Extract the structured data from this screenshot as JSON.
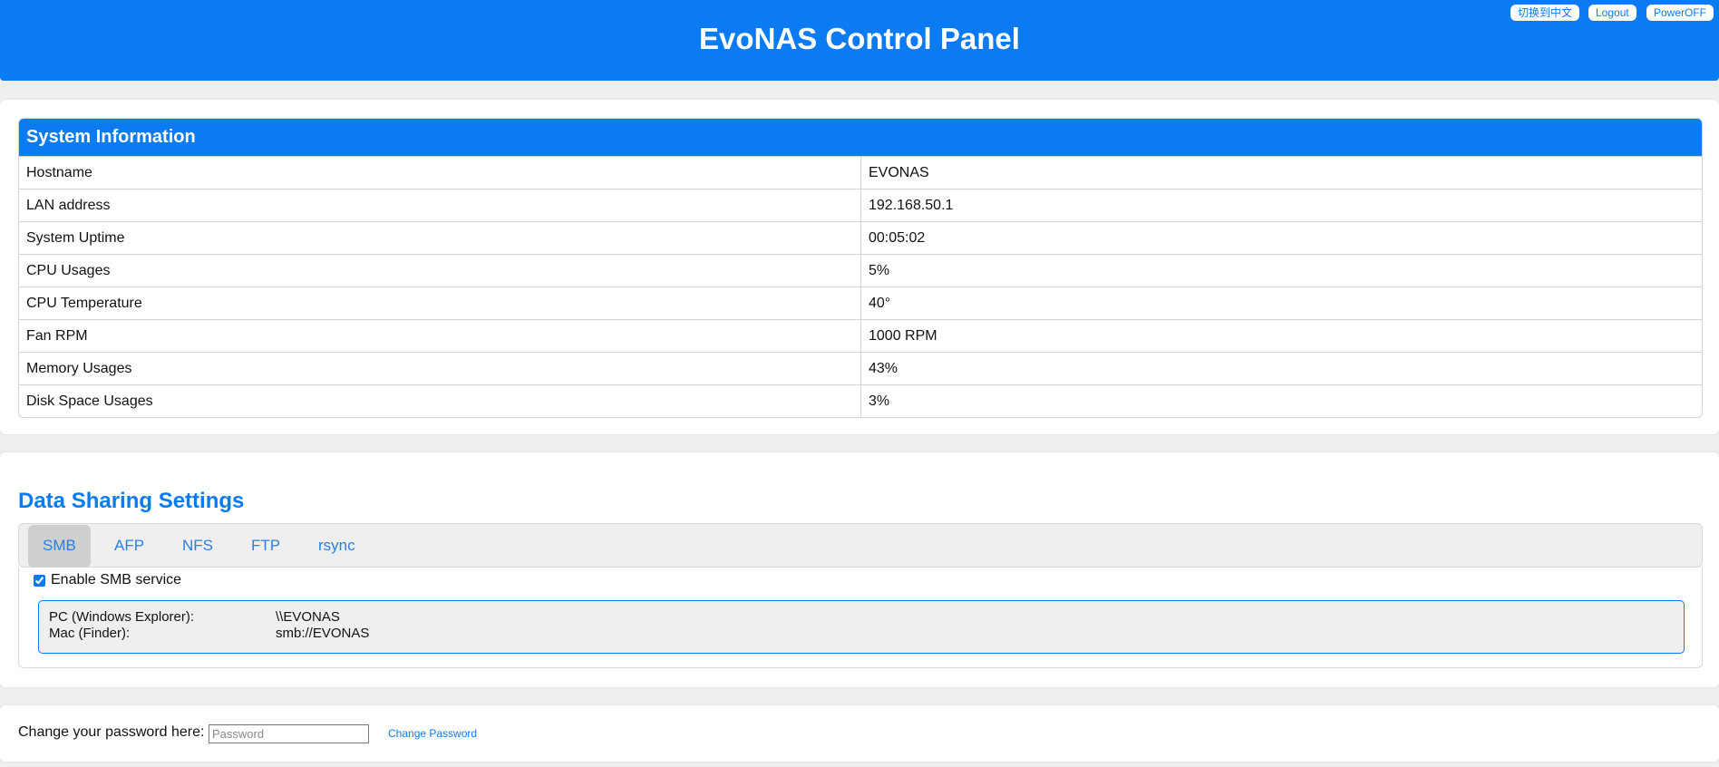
{
  "header": {
    "title": "EvoNAS Control Panel",
    "lang_button": "切换到中文",
    "logout_button": "Logout",
    "poweroff_button": "PowerOFF"
  },
  "system_info": {
    "title": "System Information",
    "rows": [
      {
        "label": "Hostname",
        "value": "EVONAS"
      },
      {
        "label": "LAN address",
        "value": "192.168.50.1"
      },
      {
        "label": "System Uptime",
        "value": "00:05:02"
      },
      {
        "label": "CPU Usages",
        "value": "5%"
      },
      {
        "label": "CPU Temperature",
        "value": "40°"
      },
      {
        "label": "Fan RPM",
        "value": "1000 RPM"
      },
      {
        "label": "Memory Usages",
        "value": "43%"
      },
      {
        "label": "Disk Space Usages",
        "value": "3%"
      }
    ]
  },
  "sharing": {
    "title": "Data Sharing Settings",
    "tabs": [
      "SMB",
      "AFP",
      "NFS",
      "FTP",
      "rsync"
    ],
    "active_tab": "SMB",
    "enable_label": "Enable SMB service",
    "enabled": true,
    "paths": [
      {
        "label": "PC (Windows Explorer):",
        "value": "\\\\EVONAS"
      },
      {
        "label": "Mac (Finder):",
        "value": "smb://EVONAS"
      }
    ]
  },
  "password": {
    "label": "Change your password here:",
    "placeholder": "Password",
    "link": "Change Password"
  },
  "colors": {
    "accent": "#0a7bf2"
  }
}
